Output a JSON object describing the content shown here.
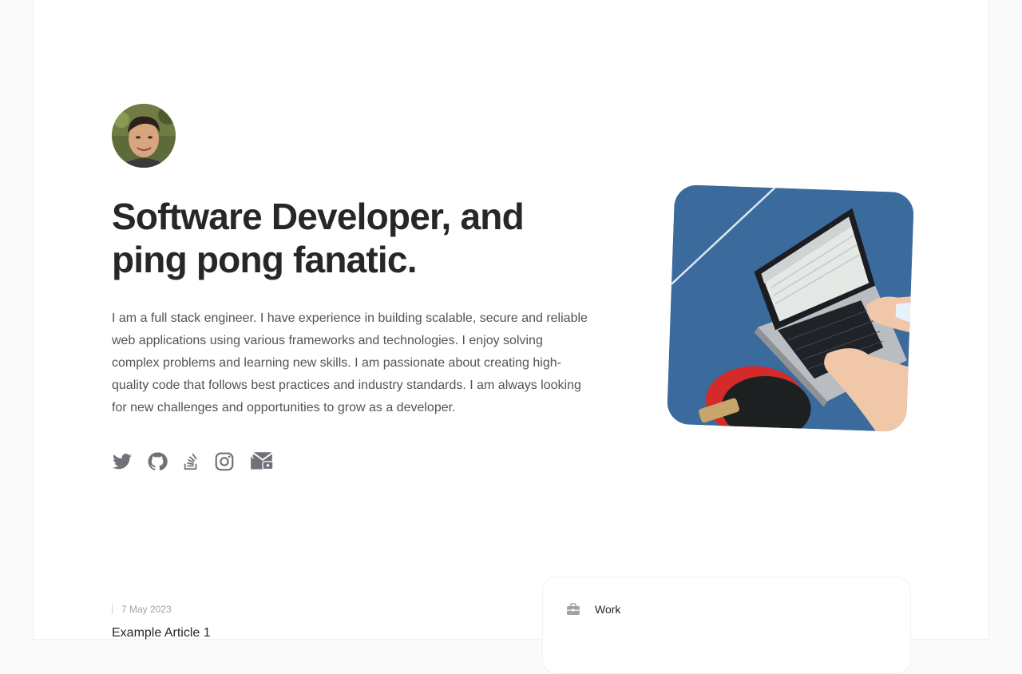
{
  "hero": {
    "headline": "Software Developer, and ping pong fanatic.",
    "bio": "I am a full stack engineer. I have experience in building scalable, secure and reliable web applications using various frameworks and technologies. I enjoy solving complex problems and learning new skills. I am passionate about creating high-quality code that follows best practices and industry standards. I am always looking for new challenges and opportunities to grow as a developer."
  },
  "socials": [
    {
      "icon": "twitter-icon"
    },
    {
      "icon": "github-icon"
    },
    {
      "icon": "stack-overflow-icon"
    },
    {
      "icon": "instagram-icon"
    },
    {
      "icon": "email-icon"
    }
  ],
  "articles": [
    {
      "date": "7 May 2023",
      "title": "Example Article 1"
    }
  ],
  "work": {
    "label": "Work",
    "icon": "briefcase-icon"
  },
  "colors": {
    "heading": "#27272a",
    "body": "#52525b",
    "icon": "#71717a",
    "muted": "#a1a1aa"
  }
}
